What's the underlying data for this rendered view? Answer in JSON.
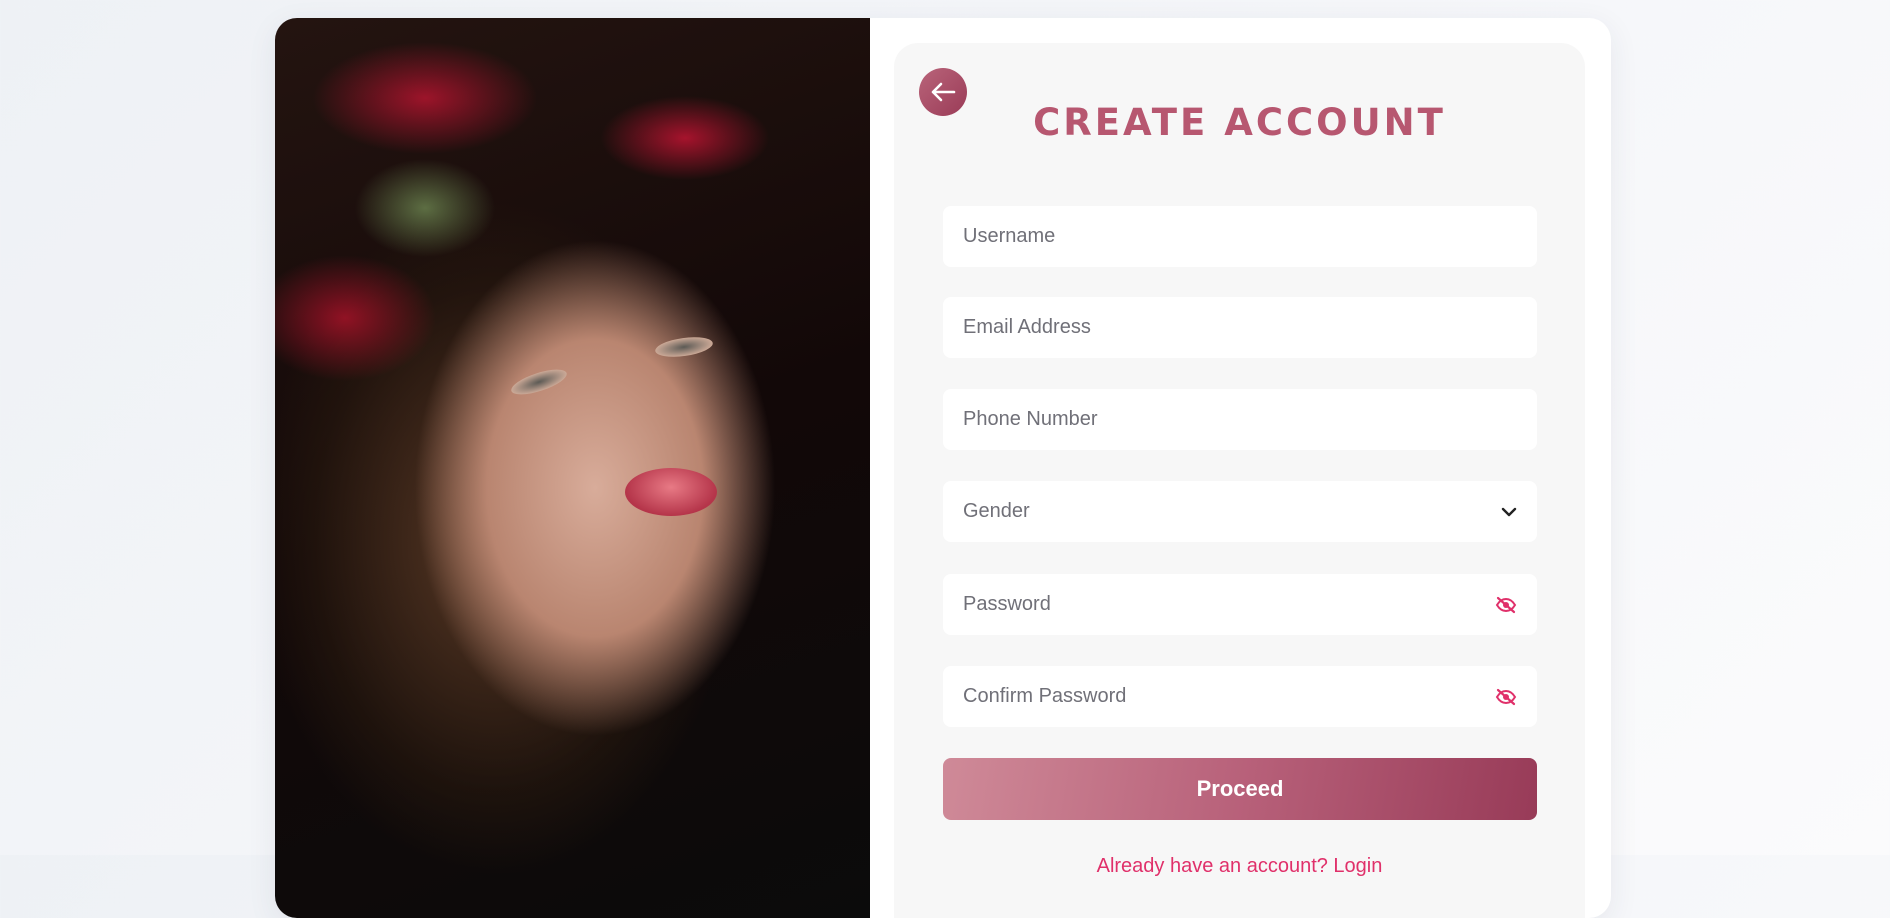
{
  "form": {
    "title": "CREATE ACCOUNT",
    "username_placeholder": "Username",
    "email_placeholder": "Email Address",
    "phone_placeholder": "Phone Number",
    "gender_selected": "Gender",
    "password_placeholder": "Password",
    "confirm_password_placeholder": "Confirm Password",
    "proceed_label": "Proceed",
    "login_link": "Already have an account? Login"
  },
  "icons": {
    "back": "arrow-left-icon",
    "password_toggle": "eye-slash-icon",
    "gender_dropdown": "chevron-down-icon"
  },
  "colors": {
    "accent": "#b75770",
    "button_start": "#cf8a98",
    "button_end": "#983b58",
    "link": "#e0306a",
    "eye_icon": "#e0306a"
  }
}
